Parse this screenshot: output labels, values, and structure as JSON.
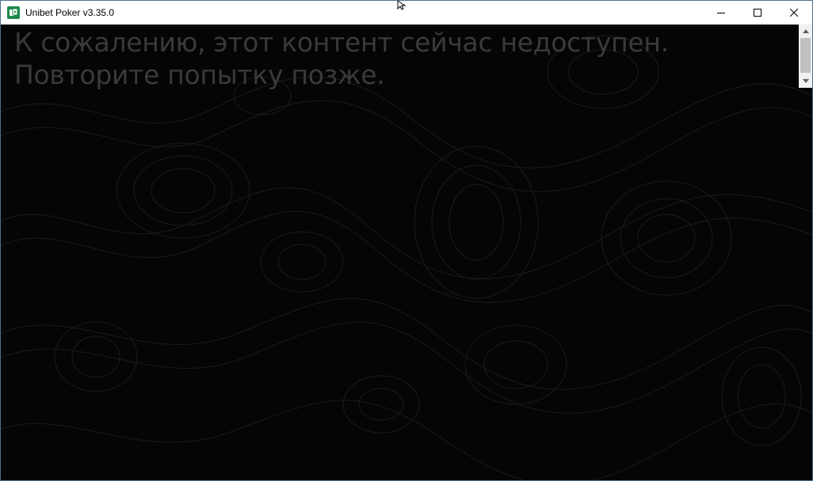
{
  "window": {
    "title": "Unibet Poker v3.35.0",
    "icon": "unibet-logo-icon",
    "accent_color": "#1d8a4f",
    "controls": [
      "minimize-icon",
      "maximize-icon",
      "close-icon"
    ]
  },
  "content": {
    "message_line1": "К сожалению, этот контент сейчас недоступен.",
    "message_line2": "Повторите попытку позже.",
    "background_color": "#050505",
    "text_color": "#3a3a3a"
  },
  "scrollbar": {
    "up_icon": "arrow-up-icon",
    "down_icon": "arrow-down-icon"
  }
}
